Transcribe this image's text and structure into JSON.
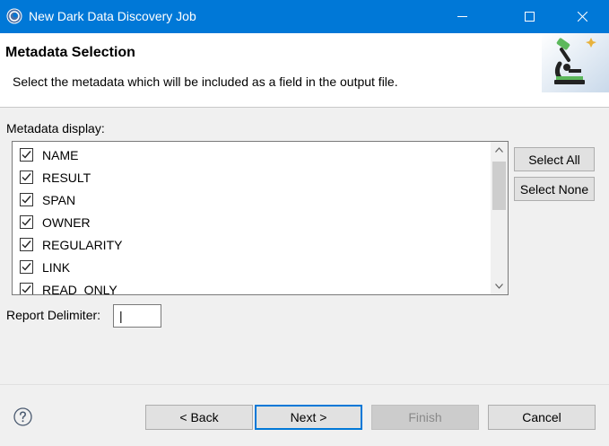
{
  "window": {
    "title": "New Dark Data Discovery Job"
  },
  "header": {
    "title": "Metadata Selection",
    "description": "Select the metadata which will be included as a field in the output file."
  },
  "metadata": {
    "label": "Metadata display:",
    "items": [
      {
        "label": "NAME",
        "checked": true
      },
      {
        "label": "RESULT",
        "checked": true
      },
      {
        "label": "SPAN",
        "checked": true
      },
      {
        "label": "OWNER",
        "checked": true
      },
      {
        "label": "REGULARITY",
        "checked": true
      },
      {
        "label": "LINK",
        "checked": true
      },
      {
        "label": "READ_ONLY",
        "checked": true
      }
    ],
    "select_all": "Select All",
    "select_none": "Select None"
  },
  "delimiter": {
    "label": "Report Delimiter:",
    "value": "|"
  },
  "footer": {
    "back": "< Back",
    "next": "Next >",
    "finish": "Finish",
    "cancel": "Cancel"
  },
  "colors": {
    "titlebar": "#0078d7",
    "accent": "#0078d7"
  }
}
